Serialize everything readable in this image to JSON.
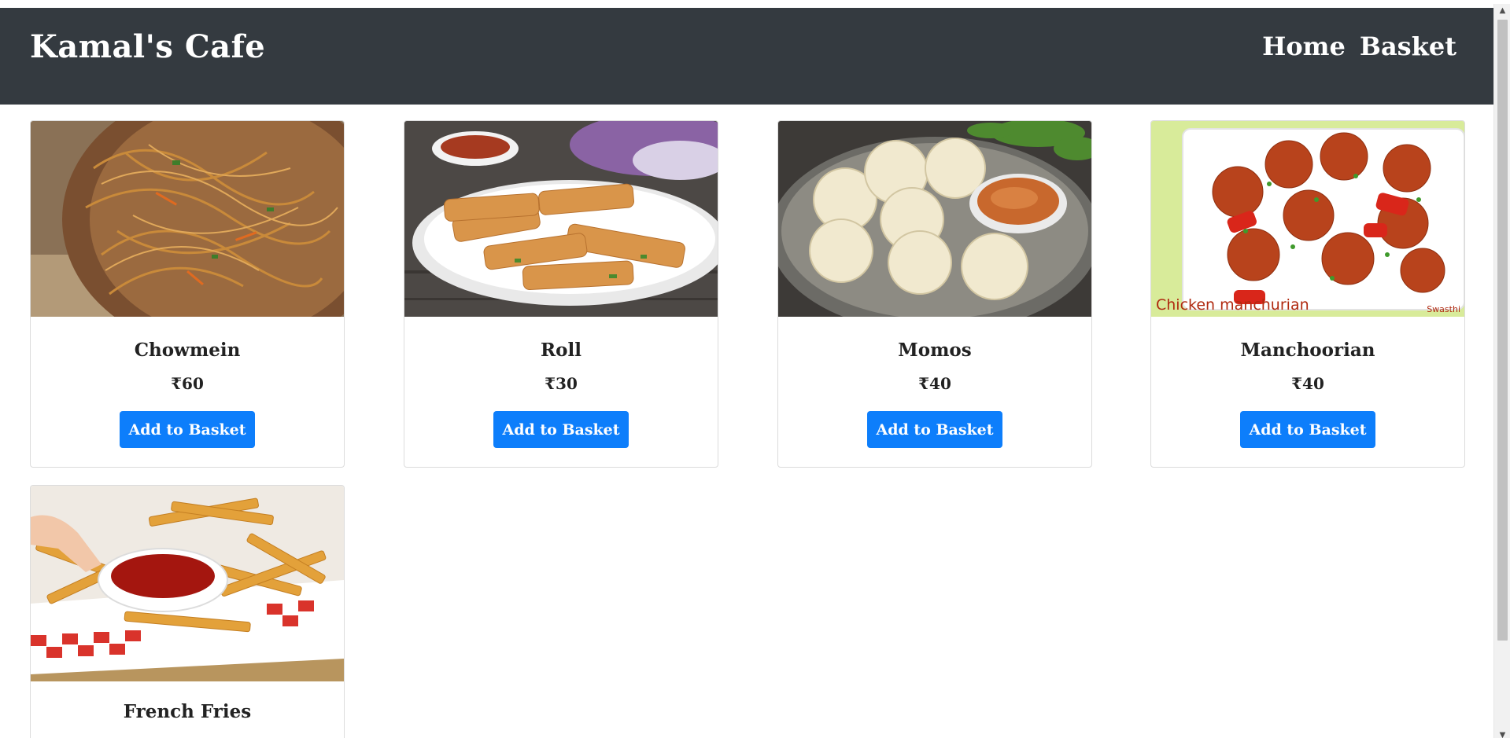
{
  "navbar": {
    "brand": "Kamal's Cafe",
    "links": [
      "Home",
      "Basket"
    ]
  },
  "menu": {
    "button_label": "Add to Basket",
    "items": [
      {
        "name": "Chowmein",
        "price": "₹60"
      },
      {
        "name": "Roll",
        "price": "₹30"
      },
      {
        "name": "Momos",
        "price": "₹40"
      },
      {
        "name": "Manchoorian",
        "price": "₹40",
        "image_caption": "Chicken manchurian",
        "image_credit": "Swasthi"
      },
      {
        "name": "French Fries"
      }
    ]
  },
  "colors": {
    "navbar_bg": "#343a40",
    "button_bg": "#0d7efb",
    "button_text": "#ffffff"
  }
}
